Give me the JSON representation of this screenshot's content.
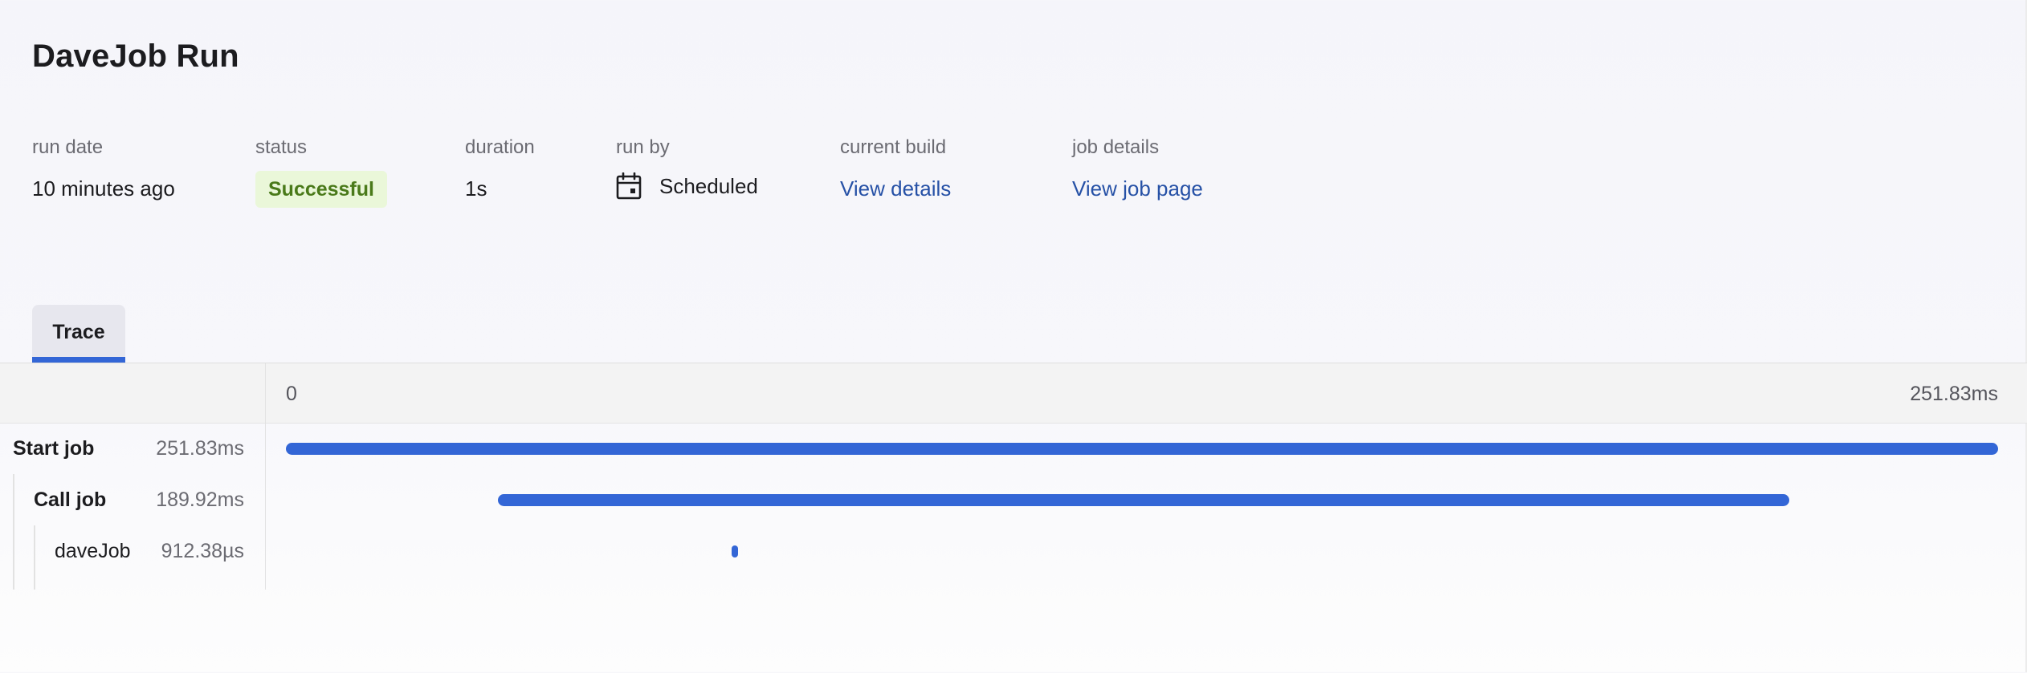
{
  "page": {
    "title": "DaveJob Run"
  },
  "meta": {
    "run_date": {
      "label": "run date",
      "value": "10 minutes ago"
    },
    "status": {
      "label": "status",
      "value": "Successful",
      "color": "#4a7a1a",
      "background": "#eaf7d9"
    },
    "duration": {
      "label": "duration",
      "value": "1s"
    },
    "run_by": {
      "label": "run by",
      "value": "Scheduled",
      "icon": "calendar-icon"
    },
    "current_build": {
      "label": "current build",
      "link": "View details"
    },
    "job_details": {
      "label": "job details",
      "link": "View job page"
    }
  },
  "tabs": [
    {
      "label": "Trace",
      "active": true
    }
  ],
  "trace": {
    "axis_start": "0",
    "axis_end": "251.83ms",
    "total_ms": 251.83,
    "bar_color": "#3366d6",
    "spans": [
      {
        "name": "Start job",
        "duration": "251.83ms",
        "depth": 0,
        "bold": true,
        "start_ms": 0,
        "duration_ms": 251.83
      },
      {
        "name": "Call job",
        "duration": "189.92ms",
        "depth": 1,
        "bold": true,
        "start_ms": 31.2,
        "duration_ms": 189.92
      },
      {
        "name": "daveJob",
        "duration": "912.38µs",
        "depth": 2,
        "bold": false,
        "start_ms": 65.6,
        "duration_ms": 0.91238
      }
    ]
  }
}
